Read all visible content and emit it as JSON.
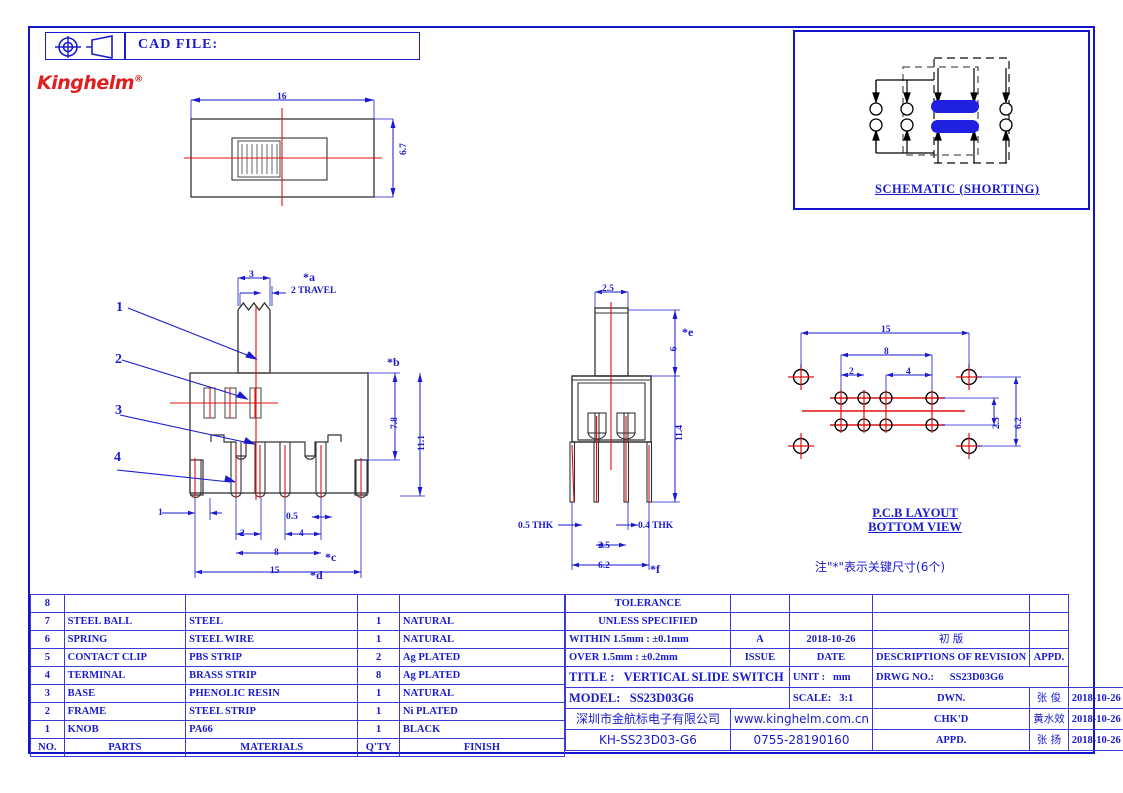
{
  "header": {
    "projection_symbol": "first-angle-projection",
    "cad_file_label": "CAD FILE:",
    "logo_text": "Kinghelm",
    "logo_tm": "®",
    "logo_color": "#e02020"
  },
  "schematic": {
    "title": "SCHEMATIC (SHORTING)",
    "contact_color": "#2020e0",
    "pole_count": 2,
    "pins_per_pole": 4
  },
  "views": {
    "top_view": {
      "dims": [
        {
          "label": "16",
          "orient": "h"
        },
        {
          "label": "6.7",
          "orient": "v"
        }
      ]
    },
    "side_view": {
      "leaders": [
        "1",
        "2",
        "3",
        "4"
      ],
      "dims": [
        {
          "label": "3",
          "orient": "h"
        },
        {
          "label": "2 TRAVEL",
          "orient": "h"
        },
        {
          "label": "*a",
          "orient": "star"
        },
        {
          "label": "*b",
          "orient": "star"
        },
        {
          "label": "7.8",
          "orient": "v"
        },
        {
          "label": "11.1",
          "orient": "v"
        },
        {
          "label": "1",
          "orient": "h"
        },
        {
          "label": "0.5",
          "orient": "h"
        },
        {
          "label": "2",
          "orient": "h"
        },
        {
          "label": "4",
          "orient": "h"
        },
        {
          "label": "8",
          "orient": "h"
        },
        {
          "label": "*c",
          "orient": "star"
        },
        {
          "label": "15",
          "orient": "h"
        },
        {
          "label": "*d",
          "orient": "star"
        }
      ]
    },
    "front_view": {
      "dims": [
        {
          "label": "2.5",
          "orient": "h"
        },
        {
          "label": "6",
          "orient": "v"
        },
        {
          "label": "*e",
          "orient": "star"
        },
        {
          "label": "11.4",
          "orient": "v"
        },
        {
          "label": "0.5 THK",
          "orient": "h"
        },
        {
          "label": "0.4 THK",
          "orient": "h"
        },
        {
          "label": "2.5",
          "orient": "h"
        },
        {
          "label": "6.2",
          "orient": "h"
        },
        {
          "label": "*f",
          "orient": "star"
        }
      ]
    },
    "pcb_view": {
      "title_line1": "P.C.B LAYOUT",
      "title_line2": "BOTTOM VIEW",
      "dims": [
        {
          "label": "15",
          "orient": "h"
        },
        {
          "label": "8",
          "orient": "h"
        },
        {
          "label": "2",
          "orient": "h"
        },
        {
          "label": "4",
          "orient": "h"
        },
        {
          "label": "2.5",
          "orient": "v"
        },
        {
          "label": "6.2",
          "orient": "v"
        }
      ]
    },
    "note": "注\"*\"表示关键尺寸(6个)"
  },
  "parts_table": {
    "columns": [
      "NO.",
      "PARTS",
      "MATERIALS",
      "Q'TY",
      "FINISH"
    ],
    "rows": [
      {
        "no": "8",
        "part": "",
        "material": "",
        "qty": "",
        "finish": ""
      },
      {
        "no": "7",
        "part": "STEEL BALL",
        "material": "STEEL",
        "qty": "1",
        "finish": "NATURAL"
      },
      {
        "no": "6",
        "part": "SPRING",
        "material": "STEEL WIRE",
        "qty": "1",
        "finish": "NATURAL"
      },
      {
        "no": "5",
        "part": "CONTACT CLIP",
        "material": "PBS STRIP",
        "qty": "2",
        "finish": "Ag PLATED"
      },
      {
        "no": "4",
        "part": "TERMINAL",
        "material": "BRASS STRIP",
        "qty": "8",
        "finish": "Ag PLATED"
      },
      {
        "no": "3",
        "part": "BASE",
        "material": "PHENOLIC RESIN",
        "qty": "1",
        "finish": "NATURAL"
      },
      {
        "no": "2",
        "part": "FRAME",
        "material": "STEEL STRIP",
        "qty": "1",
        "finish": "Ni PLATED"
      },
      {
        "no": "1",
        "part": "KNOB",
        "material": "PA66",
        "qty": "1",
        "finish": "BLACK"
      }
    ]
  },
  "title_block": {
    "tolerance_line1": "TOLERANCE",
    "tolerance_line2": "UNLESS  SPECIFIED",
    "tolerance_within": "WITHIN 1.5mm : ±0.1mm",
    "tolerance_over": "OVER 1.5mm : ±0.2mm",
    "issue_header": "ISSUE",
    "date_header": "DATE",
    "revision_header": "DESCRIPTIONS OF REVISION",
    "appd_header": "APPD.",
    "issue_value": "A",
    "issue_date": "2018-10-26",
    "revision_desc": "初  版",
    "revision_appd": "",
    "title_label": "TITLE :",
    "title_value": "VERTICAL SLIDE SWITCH",
    "model_label": "MODEL:",
    "model_value": "SS23D03G6",
    "company_cn": "深圳市金航标电子有限公司",
    "part_number": "KH-SS23D03-G6",
    "unit_label": "UNIT :",
    "unit_value": "mm",
    "scale_label": "SCALE:",
    "scale_value": "3:1",
    "website": "www.kinghelm.com.cn",
    "phone": "0755-28190160",
    "drwg_no_label": "DRWG NO.:",
    "drwg_no_value": "SS23D03G6",
    "signoff": [
      {
        "role": "DWN.",
        "name": "张  俊",
        "date": "2018-10-26"
      },
      {
        "role": "CHK'D",
        "name": "黄水效",
        "date": "2018-10-26"
      },
      {
        "role": "APPD.",
        "name": "张  扬",
        "date": "2018-10-26"
      }
    ]
  }
}
